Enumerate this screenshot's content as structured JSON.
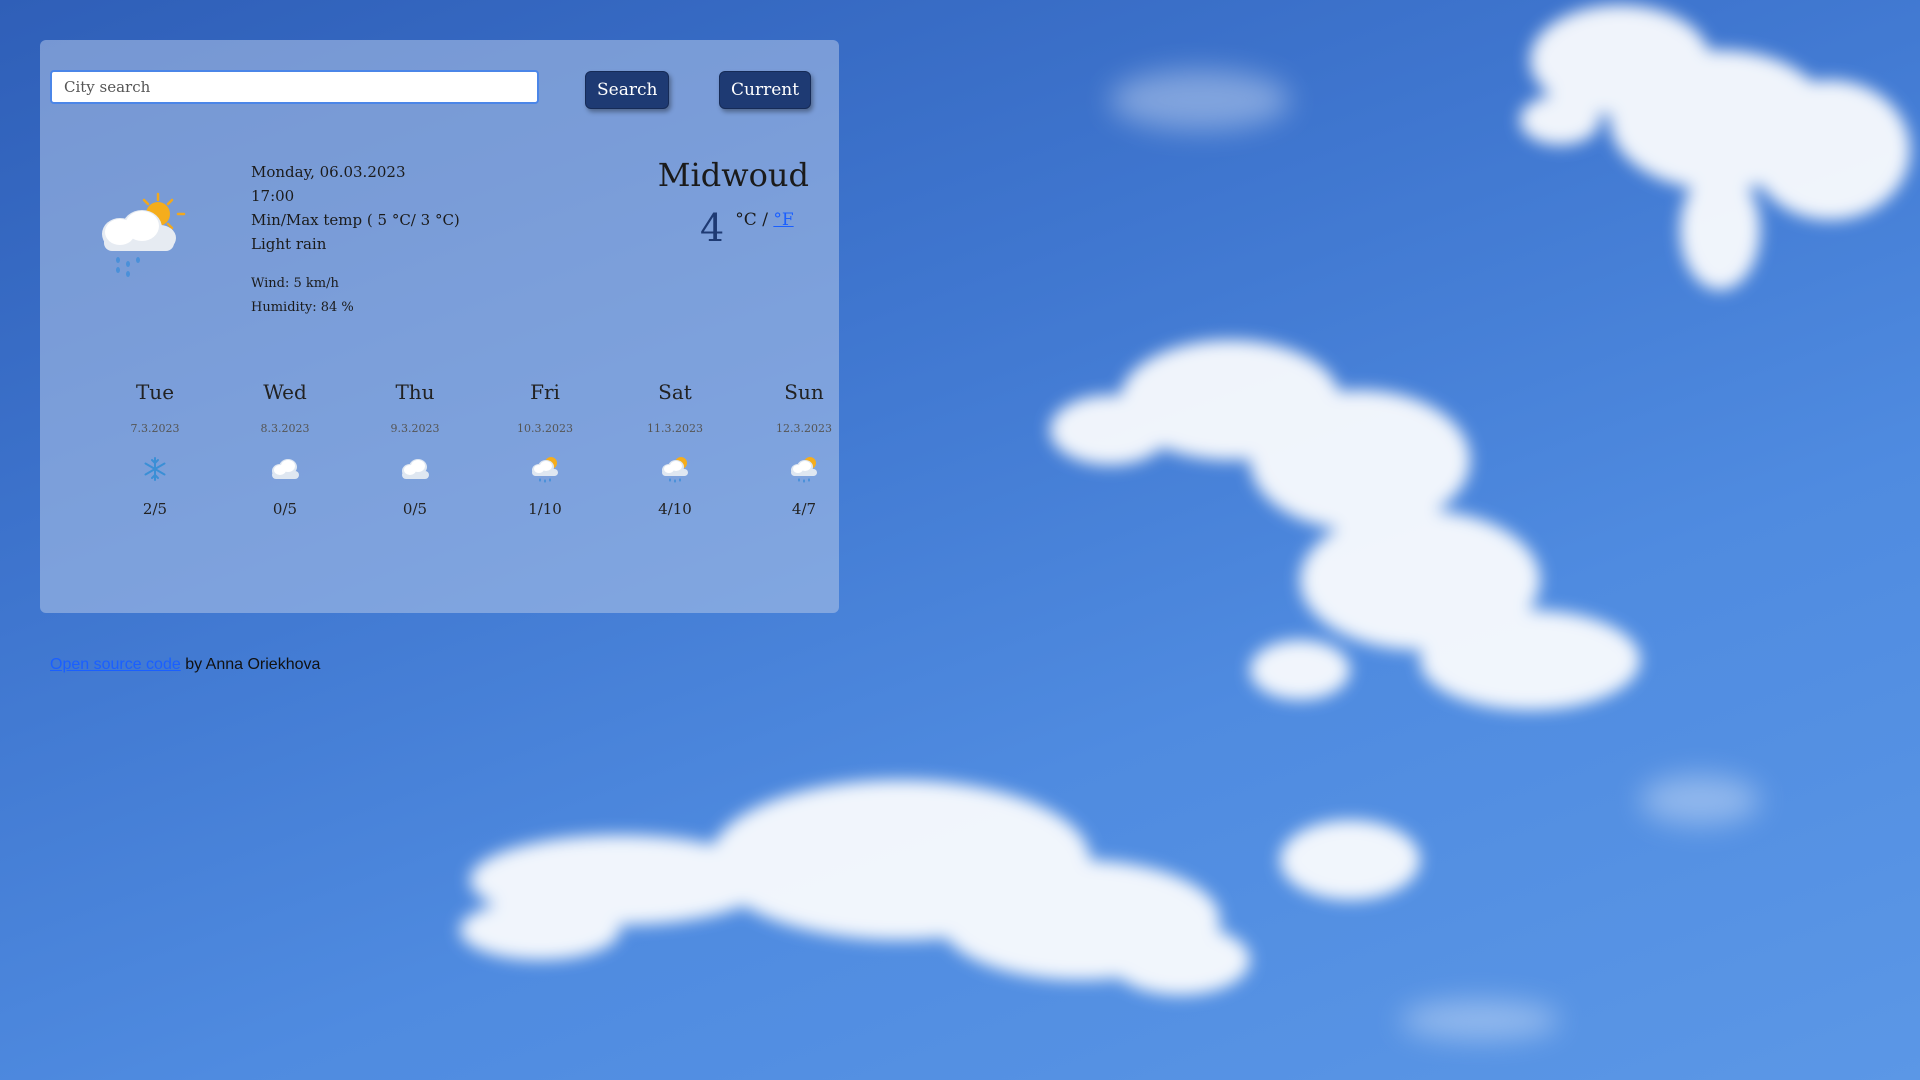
{
  "search": {
    "placeholder": "City search",
    "value": "",
    "search_label": "Search",
    "current_label": "Current"
  },
  "current": {
    "date": "Monday, 06.03.2023",
    "time": "17:00",
    "minmax": "Min/Max temp ( 5 °C/ 3 °C)",
    "description": "Light rain",
    "wind": "Wind: 5 km/h",
    "humidity": "Humidity: 84 %",
    "icon": "sun-cloud-rain-icon",
    "city": "Midwoud",
    "temperature": "4",
    "unit_celsius": "°C",
    "unit_sep": " / ",
    "unit_fahrenheit": "°F"
  },
  "forecast": [
    {
      "day": "Tue",
      "date": "7.3.2023",
      "icon": "snowflake-icon",
      "temps": "2/5"
    },
    {
      "day": "Wed",
      "date": "8.3.2023",
      "icon": "cloud-icon",
      "temps": "0/5"
    },
    {
      "day": "Thu",
      "date": "9.3.2023",
      "icon": "cloud-icon",
      "temps": "0/5"
    },
    {
      "day": "Fri",
      "date": "10.3.2023",
      "icon": "sun-cloud-rain-icon",
      "temps": "1/10"
    },
    {
      "day": "Sat",
      "date": "11.3.2023",
      "icon": "sun-cloud-rain-icon",
      "temps": "4/10"
    },
    {
      "day": "Sun",
      "date": "12.3.2023",
      "icon": "sun-cloud-rain-icon",
      "temps": "4/7"
    }
  ],
  "footer": {
    "link_text": "Open source code",
    "suffix": " by Anna Oriekhova"
  },
  "colors": {
    "accent": "#1e3a73",
    "link": "#1a5fff",
    "sky": "#4f8be0"
  }
}
